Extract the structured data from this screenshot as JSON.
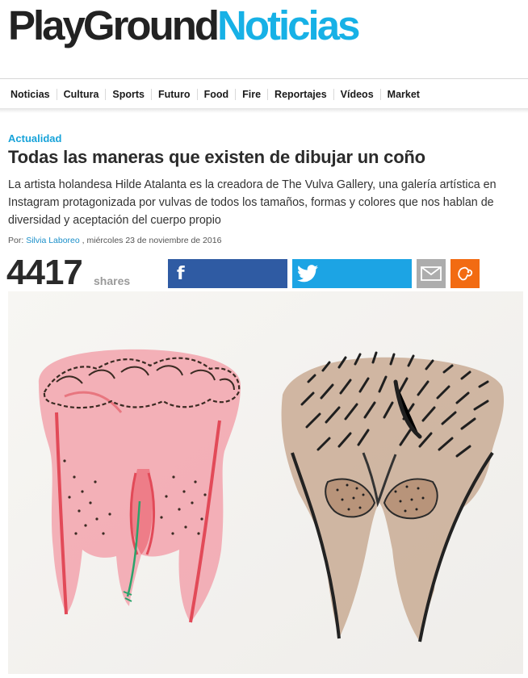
{
  "logo": {
    "part1": "PlayGround",
    "part2": "Noticias"
  },
  "nav": {
    "items": [
      "Noticias",
      "Cultura",
      "Sports",
      "Futuro",
      "Food",
      "Fire",
      "Reportajes",
      "Vídeos",
      "Market"
    ]
  },
  "article": {
    "category": "Actualidad",
    "title": "Todas las maneras que existen de dibujar un coño",
    "summary": "La artista holandesa Hilde Atalanta es la creadora de The Vulva Gallery, una galería artística en Instagram protagonizada por vulvas de todos los tamaños, formas y colores que nos hablan de diversidad y aceptación del cuerpo propio",
    "byline_prefix": "Por: ",
    "author": "Silvia Laboreo",
    "date": " , miércoles 23 de noviembre de 2016"
  },
  "share": {
    "count": "4417",
    "label": "shares",
    "buttons": [
      {
        "icon": "facebook-icon",
        "color": "#2f5ba3"
      },
      {
        "icon": "twitter-icon",
        "color": "#1ca4e4"
      },
      {
        "icon": "mail-icon",
        "color": "#adadad"
      },
      {
        "icon": "share-other-icon",
        "color": "#f26b12"
      }
    ]
  },
  "colors": {
    "brand_dark": "#222222",
    "brand_accent": "#17b1e6",
    "link": "#1a8fc9"
  }
}
